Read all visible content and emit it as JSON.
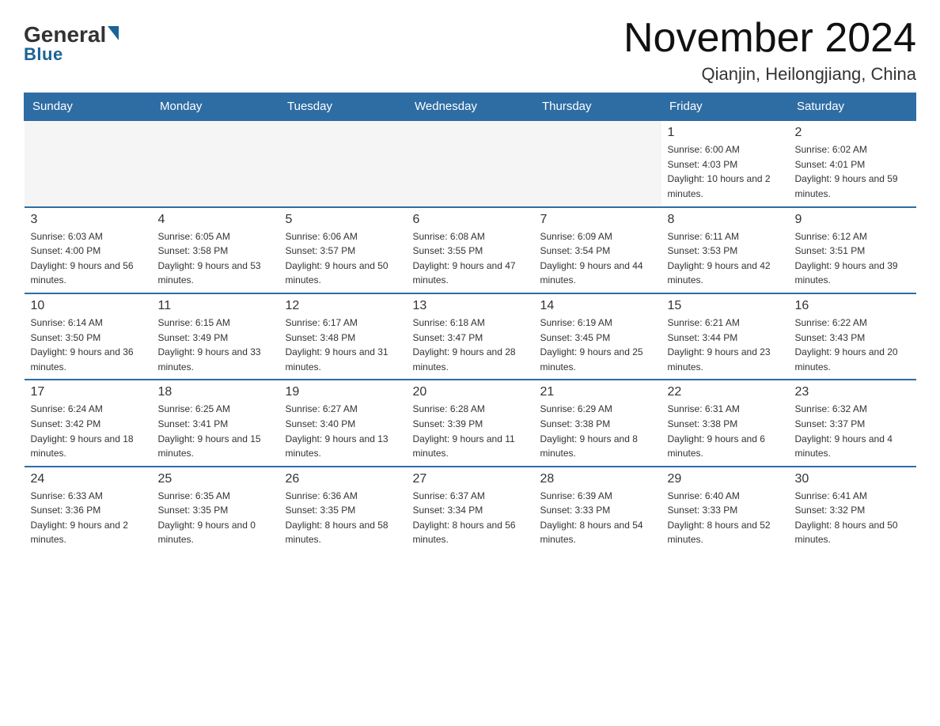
{
  "header": {
    "logo_main": "General",
    "logo_sub": "Blue",
    "title": "November 2024",
    "subtitle": "Qianjin, Heilongjiang, China"
  },
  "days_of_week": [
    "Sunday",
    "Monday",
    "Tuesday",
    "Wednesday",
    "Thursday",
    "Friday",
    "Saturday"
  ],
  "weeks": [
    {
      "days": [
        {
          "num": "",
          "empty": true
        },
        {
          "num": "",
          "empty": true
        },
        {
          "num": "",
          "empty": true
        },
        {
          "num": "",
          "empty": true
        },
        {
          "num": "",
          "empty": true
        },
        {
          "num": "1",
          "sunrise": "Sunrise: 6:00 AM",
          "sunset": "Sunset: 4:03 PM",
          "daylight": "Daylight: 10 hours and 2 minutes."
        },
        {
          "num": "2",
          "sunrise": "Sunrise: 6:02 AM",
          "sunset": "Sunset: 4:01 PM",
          "daylight": "Daylight: 9 hours and 59 minutes."
        }
      ]
    },
    {
      "days": [
        {
          "num": "3",
          "sunrise": "Sunrise: 6:03 AM",
          "sunset": "Sunset: 4:00 PM",
          "daylight": "Daylight: 9 hours and 56 minutes."
        },
        {
          "num": "4",
          "sunrise": "Sunrise: 6:05 AM",
          "sunset": "Sunset: 3:58 PM",
          "daylight": "Daylight: 9 hours and 53 minutes."
        },
        {
          "num": "5",
          "sunrise": "Sunrise: 6:06 AM",
          "sunset": "Sunset: 3:57 PM",
          "daylight": "Daylight: 9 hours and 50 minutes."
        },
        {
          "num": "6",
          "sunrise": "Sunrise: 6:08 AM",
          "sunset": "Sunset: 3:55 PM",
          "daylight": "Daylight: 9 hours and 47 minutes."
        },
        {
          "num": "7",
          "sunrise": "Sunrise: 6:09 AM",
          "sunset": "Sunset: 3:54 PM",
          "daylight": "Daylight: 9 hours and 44 minutes."
        },
        {
          "num": "8",
          "sunrise": "Sunrise: 6:11 AM",
          "sunset": "Sunset: 3:53 PM",
          "daylight": "Daylight: 9 hours and 42 minutes."
        },
        {
          "num": "9",
          "sunrise": "Sunrise: 6:12 AM",
          "sunset": "Sunset: 3:51 PM",
          "daylight": "Daylight: 9 hours and 39 minutes."
        }
      ]
    },
    {
      "days": [
        {
          "num": "10",
          "sunrise": "Sunrise: 6:14 AM",
          "sunset": "Sunset: 3:50 PM",
          "daylight": "Daylight: 9 hours and 36 minutes."
        },
        {
          "num": "11",
          "sunrise": "Sunrise: 6:15 AM",
          "sunset": "Sunset: 3:49 PM",
          "daylight": "Daylight: 9 hours and 33 minutes."
        },
        {
          "num": "12",
          "sunrise": "Sunrise: 6:17 AM",
          "sunset": "Sunset: 3:48 PM",
          "daylight": "Daylight: 9 hours and 31 minutes."
        },
        {
          "num": "13",
          "sunrise": "Sunrise: 6:18 AM",
          "sunset": "Sunset: 3:47 PM",
          "daylight": "Daylight: 9 hours and 28 minutes."
        },
        {
          "num": "14",
          "sunrise": "Sunrise: 6:19 AM",
          "sunset": "Sunset: 3:45 PM",
          "daylight": "Daylight: 9 hours and 25 minutes."
        },
        {
          "num": "15",
          "sunrise": "Sunrise: 6:21 AM",
          "sunset": "Sunset: 3:44 PM",
          "daylight": "Daylight: 9 hours and 23 minutes."
        },
        {
          "num": "16",
          "sunrise": "Sunrise: 6:22 AM",
          "sunset": "Sunset: 3:43 PM",
          "daylight": "Daylight: 9 hours and 20 minutes."
        }
      ]
    },
    {
      "days": [
        {
          "num": "17",
          "sunrise": "Sunrise: 6:24 AM",
          "sunset": "Sunset: 3:42 PM",
          "daylight": "Daylight: 9 hours and 18 minutes."
        },
        {
          "num": "18",
          "sunrise": "Sunrise: 6:25 AM",
          "sunset": "Sunset: 3:41 PM",
          "daylight": "Daylight: 9 hours and 15 minutes."
        },
        {
          "num": "19",
          "sunrise": "Sunrise: 6:27 AM",
          "sunset": "Sunset: 3:40 PM",
          "daylight": "Daylight: 9 hours and 13 minutes."
        },
        {
          "num": "20",
          "sunrise": "Sunrise: 6:28 AM",
          "sunset": "Sunset: 3:39 PM",
          "daylight": "Daylight: 9 hours and 11 minutes."
        },
        {
          "num": "21",
          "sunrise": "Sunrise: 6:29 AM",
          "sunset": "Sunset: 3:38 PM",
          "daylight": "Daylight: 9 hours and 8 minutes."
        },
        {
          "num": "22",
          "sunrise": "Sunrise: 6:31 AM",
          "sunset": "Sunset: 3:38 PM",
          "daylight": "Daylight: 9 hours and 6 minutes."
        },
        {
          "num": "23",
          "sunrise": "Sunrise: 6:32 AM",
          "sunset": "Sunset: 3:37 PM",
          "daylight": "Daylight: 9 hours and 4 minutes."
        }
      ]
    },
    {
      "days": [
        {
          "num": "24",
          "sunrise": "Sunrise: 6:33 AM",
          "sunset": "Sunset: 3:36 PM",
          "daylight": "Daylight: 9 hours and 2 minutes."
        },
        {
          "num": "25",
          "sunrise": "Sunrise: 6:35 AM",
          "sunset": "Sunset: 3:35 PM",
          "daylight": "Daylight: 9 hours and 0 minutes."
        },
        {
          "num": "26",
          "sunrise": "Sunrise: 6:36 AM",
          "sunset": "Sunset: 3:35 PM",
          "daylight": "Daylight: 8 hours and 58 minutes."
        },
        {
          "num": "27",
          "sunrise": "Sunrise: 6:37 AM",
          "sunset": "Sunset: 3:34 PM",
          "daylight": "Daylight: 8 hours and 56 minutes."
        },
        {
          "num": "28",
          "sunrise": "Sunrise: 6:39 AM",
          "sunset": "Sunset: 3:33 PM",
          "daylight": "Daylight: 8 hours and 54 minutes."
        },
        {
          "num": "29",
          "sunrise": "Sunrise: 6:40 AM",
          "sunset": "Sunset: 3:33 PM",
          "daylight": "Daylight: 8 hours and 52 minutes."
        },
        {
          "num": "30",
          "sunrise": "Sunrise: 6:41 AM",
          "sunset": "Sunset: 3:32 PM",
          "daylight": "Daylight: 8 hours and 50 minutes."
        }
      ]
    }
  ]
}
